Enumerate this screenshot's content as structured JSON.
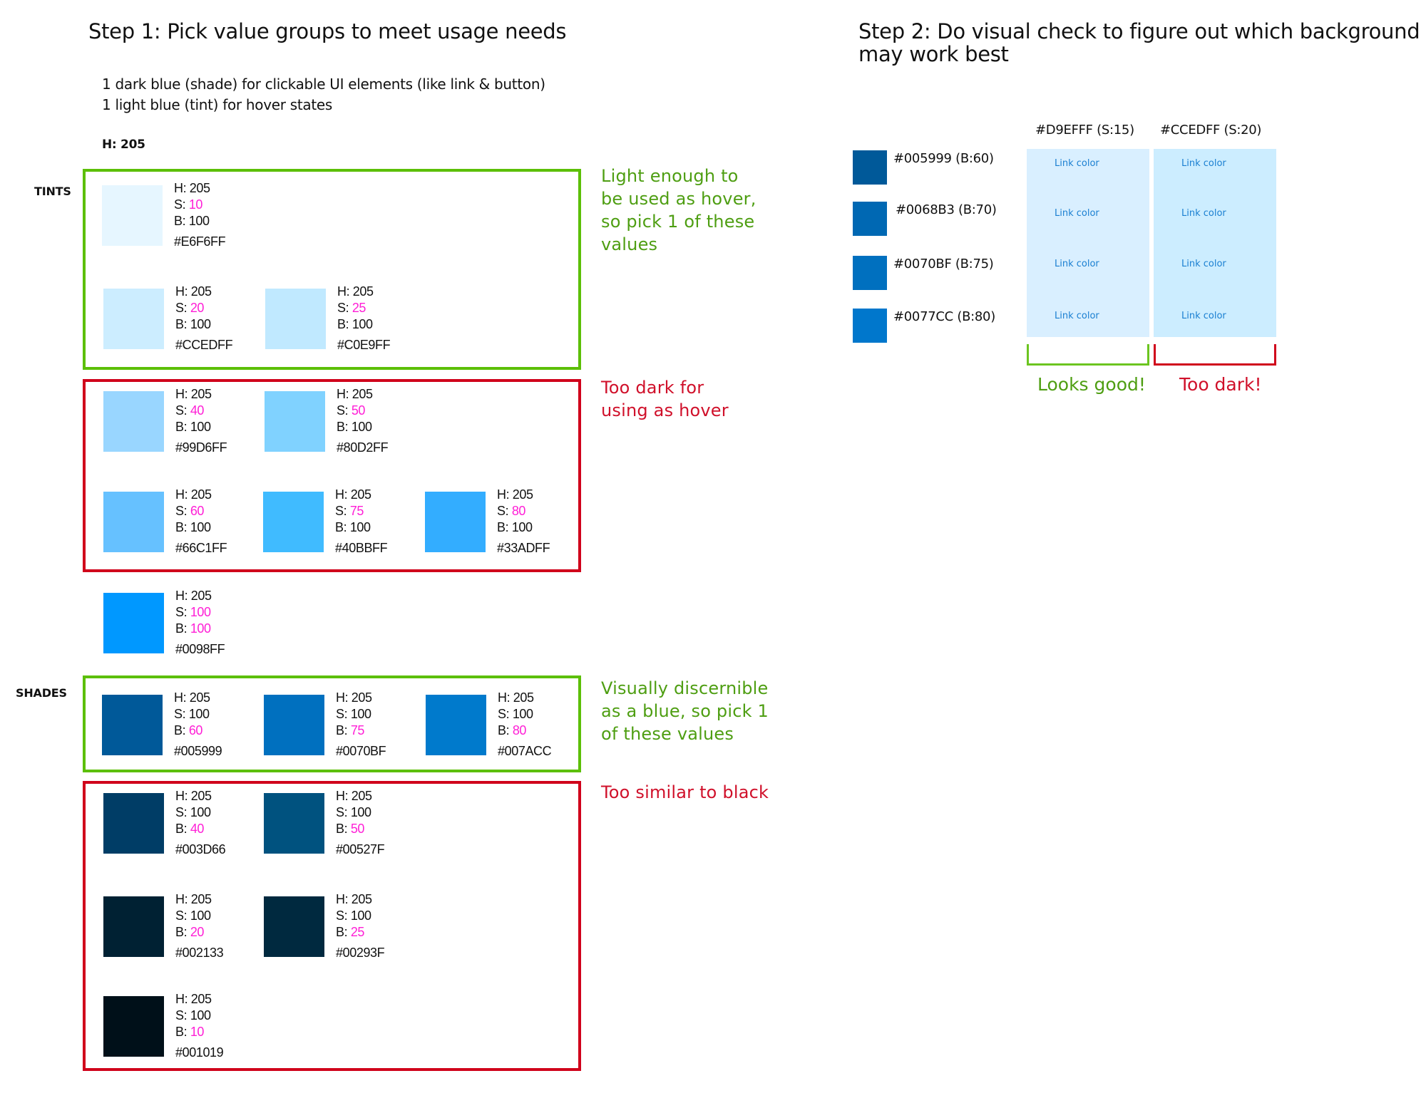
{
  "step1": {
    "title": "Step 1: Pick value groups to meet usage needs",
    "intro": [
      "1 dark blue (shade) for clickable UI elements (like link & button)",
      "1 light blue (tint) for hover states"
    ],
    "hue_label": "H: 205",
    "tints_label": "TINTS",
    "shades_label": "SHADES",
    "groups": {
      "tints_good": {
        "note": [
          "Light enough to",
          "be used as hover,",
          "so pick 1 of these",
          "values"
        ],
        "swatches": [
          {
            "h": "205",
            "s": "10",
            "b": "100",
            "hex": "#E6F6FF",
            "highlight": "s"
          },
          {
            "h": "205",
            "s": "20",
            "b": "100",
            "hex": "#CCEDFF",
            "highlight": "s"
          },
          {
            "h": "205",
            "s": "25",
            "b": "100",
            "hex": "#C0E9FF",
            "highlight": "s"
          }
        ]
      },
      "tints_bad": {
        "note": [
          "Too dark for",
          "using as hover"
        ],
        "swatches": [
          {
            "h": "205",
            "s": "40",
            "b": "100",
            "hex": "#99D6FF",
            "highlight": "s"
          },
          {
            "h": "205",
            "s": "50",
            "b": "100",
            "hex": "#80D2FF",
            "highlight": "s"
          },
          {
            "h": "205",
            "s": "60",
            "b": "100",
            "hex": "#66C1FF",
            "highlight": "s"
          },
          {
            "h": "205",
            "s": "75",
            "b": "100",
            "hex": "#40BBFF",
            "highlight": "s"
          },
          {
            "h": "205",
            "s": "80",
            "b": "100",
            "hex": "#33ADFF",
            "highlight": "s"
          }
        ]
      },
      "pure": {
        "swatches": [
          {
            "h": "205",
            "s": "100",
            "b": "100",
            "hex": "#0098FF",
            "highlight": "sb"
          }
        ]
      },
      "shades_good": {
        "note": [
          "Visually discernible",
          "as a blue, so pick 1",
          "of these values"
        ],
        "swatches": [
          {
            "h": "205",
            "s": "100",
            "b": "60",
            "hex": "#005999",
            "highlight": "b"
          },
          {
            "h": "205",
            "s": "100",
            "b": "75",
            "hex": "#0070BF",
            "highlight": "b"
          },
          {
            "h": "205",
            "s": "100",
            "b": "80",
            "hex": "#007ACC",
            "highlight": "b"
          }
        ]
      },
      "shades_bad": {
        "note": [
          "Too similar to black"
        ],
        "swatches": [
          {
            "h": "205",
            "s": "100",
            "b": "40",
            "hex": "#003D66",
            "highlight": "b"
          },
          {
            "h": "205",
            "s": "100",
            "b": "50",
            "hex": "#00527F",
            "highlight": "b"
          },
          {
            "h": "205",
            "s": "100",
            "b": "20",
            "hex": "#002133",
            "highlight": "b"
          },
          {
            "h": "205",
            "s": "100",
            "b": "25",
            "hex": "#00293F",
            "highlight": "b"
          },
          {
            "h": "205",
            "s": "100",
            "b": "10",
            "hex": "#001019",
            "highlight": "b"
          }
        ]
      }
    }
  },
  "step2": {
    "title_lines": [
      "Step 2: Do visual check to figure out which background",
      "may work best"
    ],
    "foregrounds": [
      {
        "hex": "#005999",
        "label": "#005999 (B:60)"
      },
      {
        "hex": "#0068B3",
        "label": "#0068B3 (B:70)"
      },
      {
        "hex": "#0070BF",
        "label": "#0070BF (B:75)"
      },
      {
        "hex": "#0077CC",
        "label": "#0077CC (B:80)"
      }
    ],
    "backgrounds": [
      {
        "hex": "#D9EFFF",
        "label": "#D9EFFF (S:15)",
        "verdict": "Looks good!",
        "verdict_color": "#4e9e12",
        "bracket_color": "#6cc520"
      },
      {
        "hex": "#CCEDFF",
        "label": "#CCEDFF (S:20)",
        "verdict": "Too dark!",
        "verdict_color": "#d0102a",
        "bracket_color": "#d0021b"
      }
    ],
    "link_text": "Link color"
  },
  "colors": {
    "good": "#5cbf07",
    "bad": "#d0021b",
    "highlight": "#ff1fd6"
  }
}
